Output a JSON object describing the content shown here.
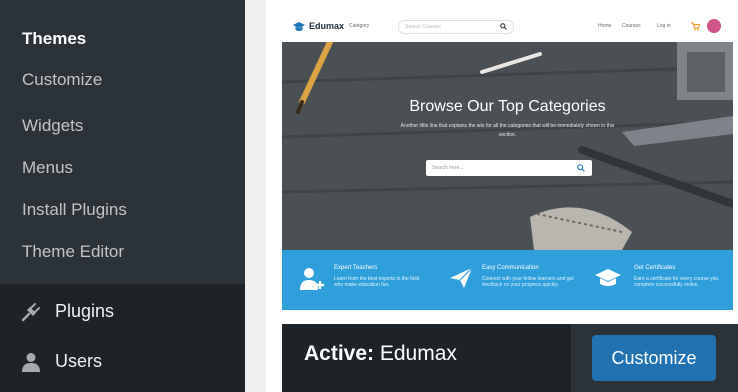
{
  "sidebar": {
    "submenu": [
      {
        "label": "Themes",
        "current": true
      },
      {
        "label": "Customize"
      },
      {
        "label": "Widgets"
      },
      {
        "label": "Menus"
      },
      {
        "label": "Install Plugins"
      },
      {
        "label": "Theme Editor"
      }
    ],
    "menu": [
      {
        "label": "Plugins",
        "icon": "plugins-icon"
      },
      {
        "label": "Users",
        "icon": "users-icon"
      }
    ]
  },
  "theme_card": {
    "screenshot": {
      "logo": "Edumax",
      "nav_category": "Category",
      "search_placeholder": "Search Courses",
      "nav_links": [
        "Home",
        "Courses",
        "Log in"
      ],
      "hero_title": "Browse Our Top Categories",
      "hero_subtitle": "Another little line that explains the site for all the categories that will be immediately shown in this section.",
      "hero_search_placeholder": "Search here...",
      "features": [
        {
          "title": "Expert Teachers",
          "desc": "Learn from the best experts in the field who make education fun.",
          "icon": "teacher-icon"
        },
        {
          "title": "Easy Communication",
          "desc": "Connect with your fellow learners and get feedback on your progress quickly.",
          "icon": "paper-plane-icon"
        },
        {
          "title": "Get Certificates",
          "desc": "Earn a certificate for every course you complete successfully online.",
          "icon": "graduation-cap-icon"
        }
      ]
    },
    "active_prefix": "Active:",
    "theme_name": "Edumax",
    "customize_label": "Customize"
  },
  "colors": {
    "sidebar_bg": "#1d2327",
    "submenu_bg": "#2c3338",
    "feature_band": "#2f9fdb",
    "button_primary": "#2271b1"
  }
}
